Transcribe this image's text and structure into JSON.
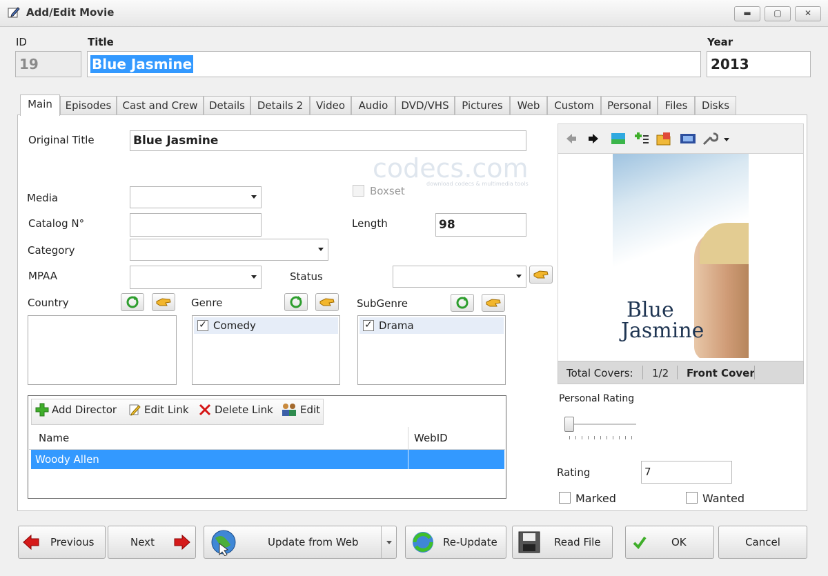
{
  "window": {
    "title": "Add/Edit Movie",
    "minimize": "▬",
    "maximize": "▢",
    "close": "✕"
  },
  "header": {
    "id_label": "ID",
    "id_value": "19",
    "title_label": "Title",
    "title_value": "Blue Jasmine",
    "year_label": "Year",
    "year_value": "2013"
  },
  "tabs": [
    "Main",
    "Episodes",
    "Cast and Crew",
    "Details",
    "Details 2",
    "Video",
    "Audio",
    "DVD/VHS",
    "Pictures",
    "Web",
    "Custom",
    "Personal",
    "Files",
    "Disks"
  ],
  "main": {
    "original_title_label": "Original Title",
    "original_title_value": "Blue Jasmine",
    "watermark": "codecs.com",
    "watermark_sub": "download codecs & multimedia tools",
    "media_label": "Media",
    "boxset_label": "Boxset",
    "catalog_label": "Catalog N°",
    "length_label": "Length",
    "length_value": "98",
    "category_label": "Category",
    "mpaa_label": "MPAA",
    "status_label": "Status",
    "country_label": "Country",
    "genre_label": "Genre",
    "genre_items": [
      "Comedy"
    ],
    "subgenre_label": "SubGenre",
    "subgenre_items": [
      "Drama"
    ]
  },
  "crew": {
    "add_director": "Add Director",
    "edit_link": "Edit Link",
    "delete_link": "Delete Link",
    "edit": "Edit",
    "col_name": "Name",
    "col_webid": "WebID",
    "rows": [
      {
        "name": "Woody Allen",
        "webid": ""
      }
    ]
  },
  "cover": {
    "poster_title_line1": "Blue",
    "poster_title_line2": "Jasmine",
    "total_covers_label": "Total Covers:",
    "total_covers_value": "1/2",
    "cover_type": "Front Cover"
  },
  "personal": {
    "personal_rating_label": "Personal Rating",
    "personal_rating_value": 0,
    "rating_label": "Rating",
    "rating_value": "7",
    "marked_label": "Marked",
    "wanted_label": "Wanted"
  },
  "bottom": {
    "previous": "Previous",
    "next": "Next",
    "update_from_web": "Update from Web",
    "re_update": "Re-Update",
    "read_file": "Read File",
    "ok": "OK",
    "cancel": "Cancel"
  },
  "colors": {
    "selection": "#3399ff",
    "title_selection": "#3399ff",
    "accent_red": "#cc1111",
    "accent_green": "#2e9e2e"
  }
}
